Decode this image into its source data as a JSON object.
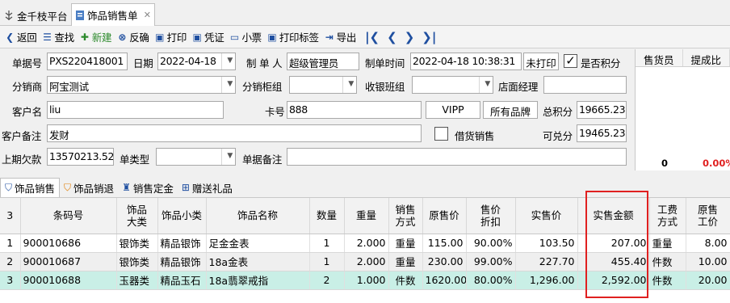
{
  "app": {
    "name": "金千枝平台",
    "tab": "饰品销售单"
  },
  "toolbar": {
    "items": [
      {
        "icon": "back-icon",
        "label": "返回"
      },
      {
        "icon": "find-icon",
        "label": "查找"
      },
      {
        "icon": "new-icon",
        "label": "新建"
      },
      {
        "icon": "unconfirm-icon",
        "label": "反确"
      },
      {
        "icon": "print-icon",
        "label": "打印"
      },
      {
        "icon": "voucher-icon",
        "label": "凭证"
      },
      {
        "icon": "ticket-icon",
        "label": "小票"
      },
      {
        "icon": "label-print-icon",
        "label": "打印标签"
      },
      {
        "icon": "export-icon",
        "label": "导出"
      }
    ]
  },
  "form": {
    "order_no_label": "单据号",
    "order_no": "PXS220418001",
    "date_label": "日期",
    "date": "2022-04-18",
    "maker_label": "制 单 人",
    "maker": "超级管理员",
    "time_label": "制单时间",
    "time": "2022-04-18 10:38:31",
    "print_status": "未打印",
    "points_check_label": "是否积分",
    "dealer_label": "分销商",
    "dealer": "阿宝测试",
    "counter_label": "分销柜组",
    "counter": "",
    "shift_label": "收银班组",
    "shift": "",
    "manager_label": "店面经理",
    "manager": "",
    "customer_label": "客户名",
    "customer": "liu",
    "card_label": "卡号",
    "card": "888",
    "level": "VIPP",
    "brand": "所有品牌",
    "total_points_label": "总积分",
    "total_points": "19665.23",
    "remark_label": "客户备注",
    "remark": "发财",
    "borrow_label": "借货销售",
    "redeem_label": "可兑分",
    "redeem": "19465.23",
    "debt_label": "上期欠款",
    "debt": "13570213.52",
    "type_label": "单类型",
    "type": "",
    "order_remark_label": "单据备注",
    "order_remark": ""
  },
  "right_panel": {
    "col1": "售货员",
    "col2": "提成比",
    "val1": "0",
    "val2": "0.00%"
  },
  "subtabs": [
    {
      "icon": "shield-icon",
      "label": "饰品销售"
    },
    {
      "icon": "return-icon",
      "label": "饰品销退"
    },
    {
      "icon": "deposit-icon",
      "label": "销售定金"
    },
    {
      "icon": "gift-icon",
      "label": "赠送礼品"
    }
  ],
  "table": {
    "row_count": "3",
    "headers": [
      "条码号",
      "饰品\n大类",
      "饰品小类",
      "饰品名称",
      "数量",
      "重量",
      "销售\n方式",
      "原售价",
      "售价\n折扣",
      "实售价",
      "实售金额",
      "工费\n方式",
      "原售\n工价"
    ],
    "rows": [
      [
        "1",
        "900010686",
        "银饰类",
        "精品银饰",
        "足金金表",
        "1",
        "2.000",
        "重量",
        "115.00",
        "90.00%",
        "103.50",
        "207.00",
        "重量",
        "8.00"
      ],
      [
        "2",
        "900010687",
        "银饰类",
        "精品银饰",
        "18a金表",
        "1",
        "2.000",
        "重量",
        "230.00",
        "99.00%",
        "227.70",
        "455.40",
        "件数",
        "10.00"
      ],
      [
        "3",
        "900010688",
        "玉器类",
        "精品玉石",
        "18a翡翠戒指",
        "2",
        "1.000",
        "件数",
        "1620.00",
        "80.00%",
        "1,296.00",
        "2,592.00",
        "件数",
        "20.00"
      ]
    ]
  },
  "colors": {
    "accent": "#1f4fa0",
    "highlight": "#e02020",
    "selected_row": "#c9efe6",
    "red_value": "#e02020"
  }
}
